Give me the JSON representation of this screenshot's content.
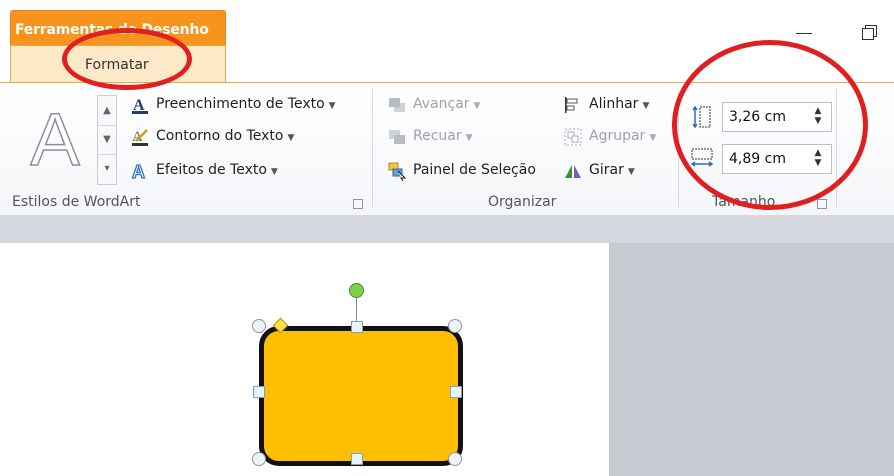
{
  "window": {
    "contextual_tab_title": "Ferramentas de Desenho",
    "active_tab": "Formatar",
    "minimize": "—",
    "restore": "❐"
  },
  "ribbon": {
    "wordart": {
      "group_label": "Estilos de WordArt",
      "letter": "A",
      "commands": {
        "fill": "Preenchimento de Texto",
        "outline": "Contorno do Texto",
        "effects": "Efeitos de Texto"
      }
    },
    "arrange": {
      "group_label": "Organizar",
      "commands": {
        "bring_forward": "Avançar",
        "send_backward": "Recuar",
        "selection_pane": "Painel de Seleção",
        "align": "Alinhar",
        "group": "Agrupar",
        "rotate": "Girar"
      }
    },
    "size": {
      "group_label": "Tamanho",
      "height": "3,26 cm",
      "width": "4,89 cm"
    }
  },
  "colors": {
    "contextual_tab": "#f7941d",
    "shape_fill": "#ffbf00",
    "annotation": "#e02020"
  }
}
